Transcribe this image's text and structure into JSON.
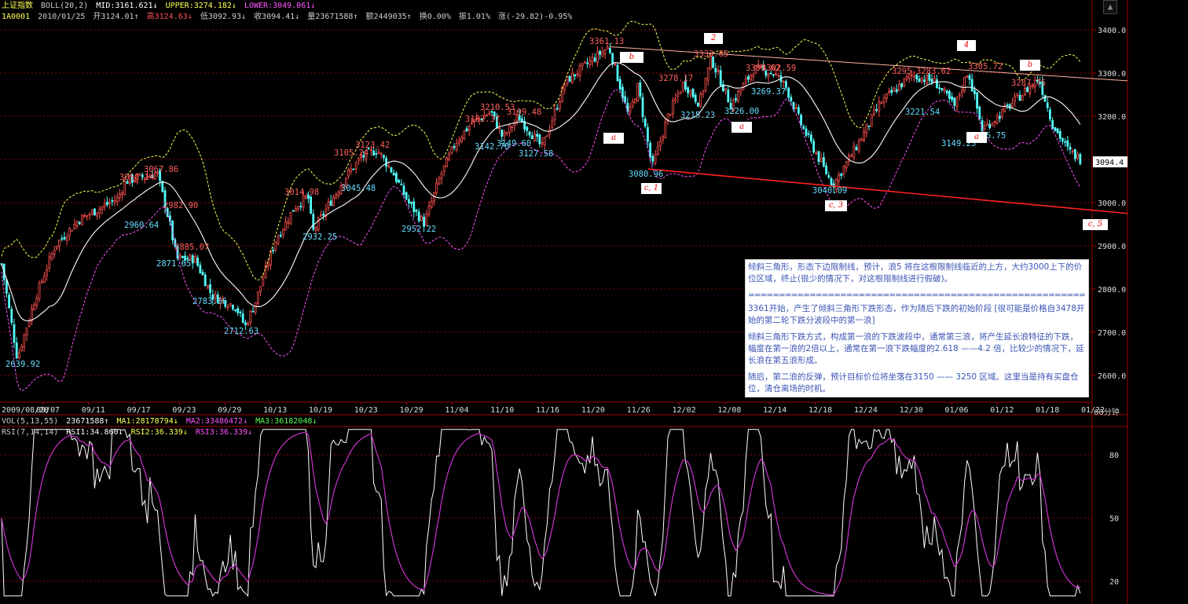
{
  "header": {
    "index_name": "上证指数",
    "boll_label": "BOLL(20,2)",
    "mid": "MID:3161.621",
    "mid_arrow": "↓",
    "upper": "UPPER:3274.182",
    "upper_arrow": "↓",
    "lower": "LOWER:3049.061",
    "lower_arrow": "↓",
    "code": "1A0001",
    "date": "2010/01/25",
    "open": "开3124.01",
    "open_arrow": "↑",
    "high": "高3124.63",
    "high_arrow": "↓",
    "low": "低3092.93",
    "low_arrow": "↓",
    "close": "收3094.41",
    "close_arrow": "↓",
    "volume": "量23671588",
    "volume_arrow": "↑",
    "amount": "额2449035",
    "amount_arrow": "↑",
    "turnover": "换0.00%",
    "amplitude": "振1.01%",
    "change": "涨(-29.82)-0.95%"
  },
  "vol_header": {
    "label": "VOL(5,13,55)",
    "value": "23671588",
    "value_arrow": "↑",
    "ma1": "MA1:28178794",
    "ma1_arrow": "↓",
    "ma2": "MA2:33486472",
    "ma2_arrow": "↓",
    "ma3": "MA3:36182048",
    "ma3_arrow": "↓"
  },
  "rsi_header": {
    "label": "RSI(7,14,14)",
    "rsi1": "RSI1:34.860",
    "rsi1_arrow": "↓",
    "rsi2": "RSI2:36.339",
    "rsi2_arrow": "↓",
    "rsi3": "RSI3:36.339",
    "rsi3_arrow": "↓"
  },
  "period_label": "60分钟",
  "scroll_button": "▲",
  "price_axis": [
    "3400.0",
    "3300.0",
    "3200.0",
    "3100.0",
    "3000.0",
    "2900.0",
    "2800.0",
    "2700.0",
    "2600.0"
  ],
  "current_price": "3094.4",
  "rsi_axis": [
    "80",
    "50",
    "20"
  ],
  "date_axis": [
    "2009/08/28",
    "09/07",
    "09/11",
    "09/17",
    "09/23",
    "09/29",
    "10/13",
    "10/19",
    "10/23",
    "10/29",
    "11/04",
    "11/10",
    "11/16",
    "11/20",
    "11/26",
    "12/02",
    "12/08",
    "12/14",
    "12/18",
    "12/24",
    "12/30",
    "01/06",
    "01/12",
    "01/18",
    "01/22"
  ],
  "price_labels": [
    {
      "text": "3361.13",
      "color": "#ff6060"
    },
    {
      "text": "3333.85",
      "color": "#ff6060"
    },
    {
      "text": "3309.62",
      "color": "#ff6060"
    },
    {
      "text": "3302.59",
      "color": "#ff6060"
    },
    {
      "text": "3278.17",
      "color": "#ff6060"
    },
    {
      "text": "3295.",
      "color": "#ff6060"
    },
    {
      "text": "3283.62",
      "color": "#ff6060"
    },
    {
      "text": "3305.72",
      "color": "#ff6060"
    },
    {
      "text": "3287.75",
      "color": "#ff6060"
    },
    {
      "text": "3269.37",
      "color": "#66ddff"
    },
    {
      "text": "3226.00",
      "color": "#66ddff"
    },
    {
      "text": "3215.23",
      "color": "#66ddff"
    },
    {
      "text": "3221.54",
      "color": "#66ddff"
    },
    {
      "text": "3149.23",
      "color": "#66ddff"
    },
    {
      "text": "3165.75",
      "color": "#66ddff"
    },
    {
      "text": "3080.96",
      "color": "#66ddff"
    },
    {
      "text": "3040.09",
      "color": "#66ddff"
    },
    {
      "text": "3210.53",
      "color": "#ff6060"
    },
    {
      "text": "3183.37",
      "color": "#ff6060"
    },
    {
      "text": "3199.48",
      "color": "#ff6060"
    },
    {
      "text": "3142.70",
      "color": "#66ddff"
    },
    {
      "text": "3149.60",
      "color": "#66ddff"
    },
    {
      "text": "3127.58",
      "color": "#66ddff"
    },
    {
      "text": "3105.24",
      "color": "#ff6060"
    },
    {
      "text": "3123.42",
      "color": "#ff6060"
    },
    {
      "text": "3045.48",
      "color": "#66ddff"
    },
    {
      "text": "3014.98",
      "color": "#ff6060"
    },
    {
      "text": "2932.25",
      "color": "#66ddff"
    },
    {
      "text": "2952.22",
      "color": "#66ddff"
    },
    {
      "text": "3050.14",
      "color": "#ff6060"
    },
    {
      "text": "3067.86",
      "color": "#ff6060"
    },
    {
      "text": "2960.64",
      "color": "#66ddff"
    },
    {
      "text": "2982.90",
      "color": "#ff6060"
    },
    {
      "text": "2871.65",
      "color": "#66ddff"
    },
    {
      "text": "2885.07",
      "color": "#ff6060"
    },
    {
      "text": "2783.56",
      "color": "#66ddff"
    },
    {
      "text": "2712.63",
      "color": "#66ddff"
    },
    {
      "text": "2639.92",
      "color": "#66ddff"
    }
  ],
  "wave_labels": [
    "2",
    "b",
    "4",
    "b",
    "a",
    "a",
    "a",
    "c, 1",
    "c, 3",
    "c, 5"
  ],
  "note": {
    "p1": "倾斜三角形，形态下边限制线，预计，浪5 将在这根限制线临近的上方，大约3000上下的价位区域，终止(很少的情况下，对这根限制线进行假破)。",
    "separator": "================================================================",
    "p2": "3361开始，产生了倾斜三角形下跌形态，作为随后下跌的初始阶段 [很可能是价格自3478开始的第二轮下跌分波段中的第一浪]",
    "p3": "倾斜三角形下跌方式，构成第一浪的下跌波段中，通常第三浪，将产生延长浪特征的下跌，幅度在第一浪的2倍以上，通常在第一浪下跌幅度的2.618 ——4.2 倍，比较少的情况下，延长浪在第五浪形成。",
    "p4": "随后，第二浪的反弹，预计目标价位将坐落在3150 —— 3250 区域。这里当是持有买盘仓位，清仓离场的时机。"
  },
  "colors": {
    "up": "#ff5050",
    "down": "#54fcfc",
    "boll_mid": "#ffffff",
    "boll_upper": "#ffff55",
    "boll_lower": "#ff55ff",
    "grid": "#8a0000",
    "trendline": "#ff2020",
    "rsi1": "#ffffff",
    "rsi2": "#cc33cc"
  }
}
